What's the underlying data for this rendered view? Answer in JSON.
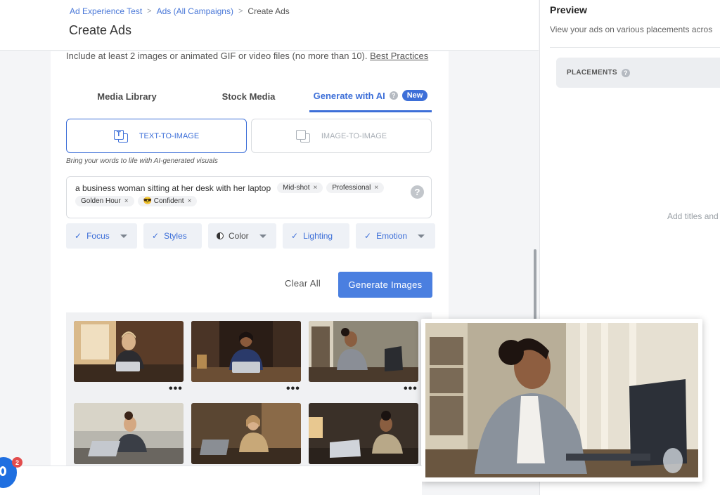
{
  "breadcrumb": {
    "items": [
      "Ad Experience Test",
      "Ads (All Campaigns)"
    ],
    "current": "Create Ads",
    "separator": ">"
  },
  "page": {
    "title": "Create Ads"
  },
  "upload": {
    "hint": "Include at least 2 images or animated GIF or video files (no more than 10).",
    "best_practices_link": "Best Practices"
  },
  "tabs": {
    "media_library": "Media Library",
    "stock_media": "Stock Media",
    "generate_ai": "Generate with AI",
    "new_badge": "New",
    "active": "generate_ai"
  },
  "modes": {
    "text_to_image": "TEXT-TO-IMAGE",
    "image_to_image": "IMAGE-TO-IMAGE",
    "caption": "Bring your words to life with AI-generated visuals"
  },
  "prompt": {
    "text": "a business woman sitting at her desk with her laptop",
    "chips": [
      "Mid-shot",
      "Professional",
      "Golden Hour",
      "😎 Confident"
    ],
    "help": "?"
  },
  "filters": [
    {
      "label": "Focus",
      "checked": true,
      "dropdown": true
    },
    {
      "label": "Styles",
      "checked": true,
      "dropdown": false
    },
    {
      "label": "Color",
      "checked": false,
      "dropdown": true
    },
    {
      "label": "Lighting",
      "checked": true,
      "dropdown": false
    },
    {
      "label": "Emotion",
      "checked": true,
      "dropdown": true
    }
  ],
  "actions": {
    "clear_all": "Clear All",
    "generate": "Generate Images"
  },
  "gallery": {
    "more_label": "•••",
    "count_visible": 6
  },
  "preview": {
    "title": "Preview",
    "subtitle": "View your ads on various placements acros",
    "placements_label": "PLACEMENTS",
    "empty_text": "Add titles and"
  },
  "chat": {
    "badge_count": "2"
  },
  "colors": {
    "accent": "#3d6fd8",
    "button": "#4a7fe0",
    "badge_red": "#e24c4c"
  }
}
